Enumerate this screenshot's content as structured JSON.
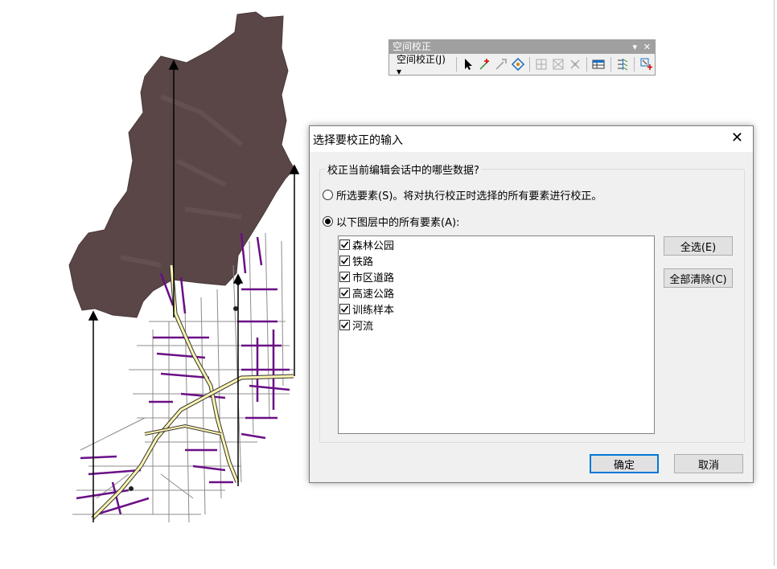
{
  "toolbar": {
    "title": "空间校正",
    "menu_label": "空间校正(J)",
    "menu_arrow": "▾",
    "title_controls": {
      "dropdown": "▾",
      "close": "✕"
    },
    "icons": [
      "select-arrow-icon",
      "new-displacement-link-icon",
      "modify-link-icon",
      "select-elements-icon",
      "view-link-table-icon",
      "set-adjust-data-icon",
      "attribute-transfer-icon",
      "link-table-icon",
      "edge-match-icon",
      "new-limited-adjust-area-icon"
    ]
  },
  "dialog": {
    "title": "选择要校正的输入",
    "close_glyph": "✕",
    "group_legend": "校正当前编辑会话中的哪些数据?",
    "option_selected_features": "所选要素(S)。将对执行校正时选择的所有要素进行校正。",
    "option_all_features": "以下图层中的所有要素(A):",
    "selected_option": "all_features",
    "layers": [
      {
        "label": "森林公园",
        "checked": true
      },
      {
        "label": "铁路",
        "checked": true
      },
      {
        "label": "市区道路",
        "checked": true
      },
      {
        "label": "高速公路",
        "checked": true
      },
      {
        "label": "训练样本",
        "checked": true
      },
      {
        "label": "河流",
        "checked": true
      }
    ],
    "select_all_label": "全选(E)",
    "clear_all_label": "全部清除(C)",
    "ok_label": "确定",
    "cancel_label": "取消"
  },
  "colors": {
    "raster": "#5a4646",
    "roads": "#6a0f86",
    "street_grid": "#8c8c8c",
    "highway_fill": "#fff5b0",
    "accent": "#0078d7"
  }
}
